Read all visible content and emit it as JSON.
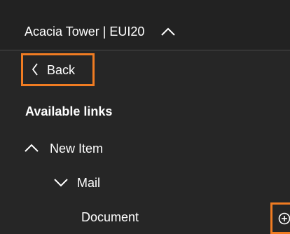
{
  "header": {
    "title": "Acacia Tower | EUI20",
    "toggle_icon": "chevron-up-icon"
  },
  "nav": {
    "back_label": "Back",
    "back_icon": "chevron-left-icon"
  },
  "links": {
    "section_title": "Available links",
    "tree": [
      {
        "label": "New Item",
        "state": "expanded",
        "icon": "chevron-up-icon"
      },
      {
        "label": "Mail",
        "state": "collapsed",
        "icon": "chevron-down-icon"
      },
      {
        "label": "Document",
        "action_icon": "add-circle-icon"
      }
    ]
  },
  "colors": {
    "highlight": "#f07c22",
    "background": "#262626",
    "text": "#ffffff"
  }
}
